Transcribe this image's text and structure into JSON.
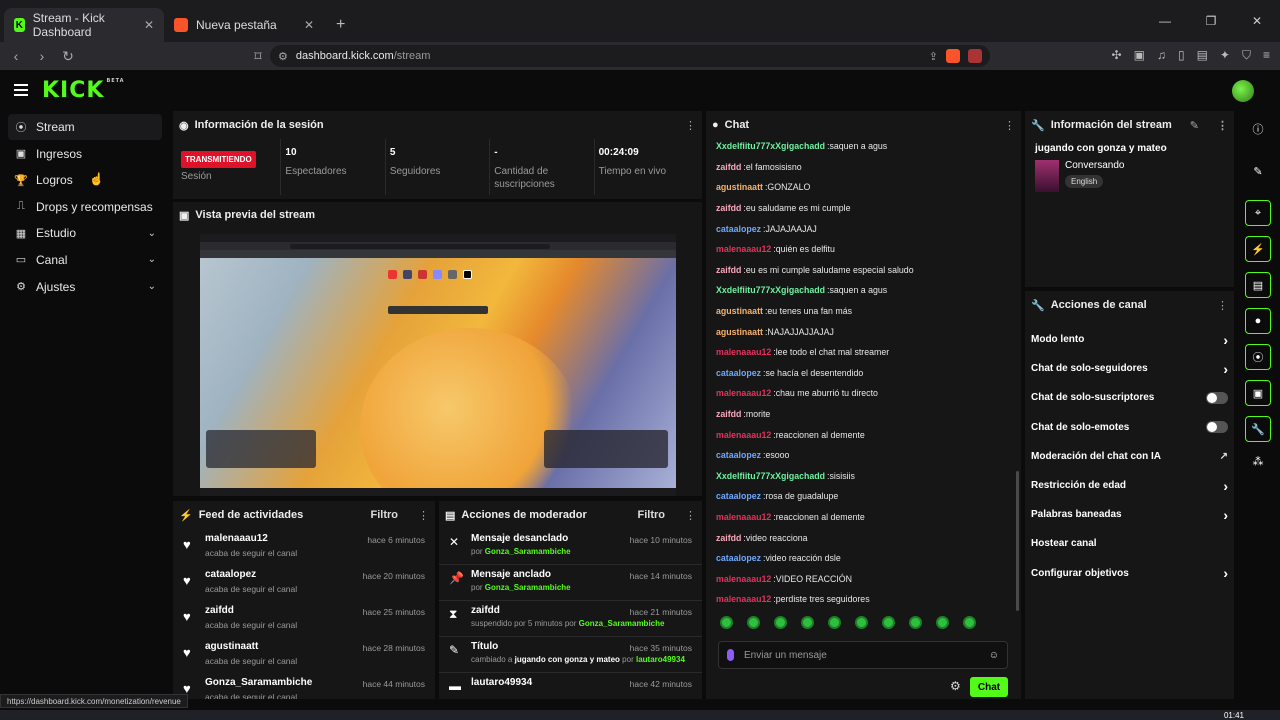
{
  "browser": {
    "tabs": [
      {
        "title": "Stream - Kick Dashboard",
        "active": true
      },
      {
        "title": "Nueva pestaña",
        "active": false
      }
    ],
    "url_host": "dashboard.kick.com",
    "url_path": "/stream",
    "status_url": "https://dashboard.kick.com/monetization/revenue",
    "clock": "01:41"
  },
  "brand": {
    "logo": "KICK",
    "beta": "BETA",
    "accent": "#53fc18"
  },
  "sidebar": {
    "items": [
      {
        "label": "Stream",
        "icon": "broadcast-icon",
        "chevron": false
      },
      {
        "label": "Ingresos",
        "icon": "revenue-icon",
        "chevron": false
      },
      {
        "label": "Logros",
        "icon": "trophy-icon",
        "chevron": false
      },
      {
        "label": "Drops y recompensas",
        "icon": "gift-icon",
        "chevron": false
      },
      {
        "label": "Estudio",
        "icon": "studio-icon",
        "chevron": true
      },
      {
        "label": "Canal",
        "icon": "channel-icon",
        "chevron": true
      },
      {
        "label": "Ajustes",
        "icon": "gear-icon",
        "chevron": true
      }
    ]
  },
  "session": {
    "title": "Información de la sesión",
    "live_badge": "TRANSMITIENDO",
    "stats": [
      {
        "value": "",
        "label": "Sesión"
      },
      {
        "value": "10",
        "label": "Espectadores"
      },
      {
        "value": "5",
        "label": "Seguidores"
      },
      {
        "value": "-",
        "label": "Cantidad de suscripciones"
      },
      {
        "value": "00:24:09",
        "label": "Tiempo en vivo"
      }
    ]
  },
  "preview": {
    "title": "Vista previa del stream"
  },
  "feed": {
    "title": "Feed de actividades",
    "filter": "Filtro",
    "items": [
      {
        "name": "malenaaau12",
        "desc": "acaba de seguir el canal",
        "time": "hace 6 minutos"
      },
      {
        "name": "cataalopez",
        "desc": "acaba de seguir el canal",
        "time": "hace 20 minutos"
      },
      {
        "name": "zaifdd",
        "desc": "acaba de seguir el canal",
        "time": "hace 25 minutos"
      },
      {
        "name": "agustinaatt",
        "desc": "acaba de seguir el canal",
        "time": "hace 28 minutos"
      },
      {
        "name": "Gonza_Saramambiche",
        "desc": "acaba de seguir el canal",
        "time": "hace 44 minutos"
      }
    ]
  },
  "mod": {
    "title": "Acciones de moderador",
    "filter": "Filtro",
    "items": [
      {
        "name": "Mensaje desanclado",
        "pre": "por",
        "user": "Gonza_Saramambiche",
        "time": "hace 10 minutos",
        "icon": "unpin-icon"
      },
      {
        "name": "Mensaje anclado",
        "pre": "por",
        "user": "Gonza_Saramambiche",
        "time": "hace 14 minutos",
        "icon": "pin-icon"
      },
      {
        "name": "zaifdd",
        "pre": "suspendido por 5 minutos por",
        "user": "Gonza_Saramambiche",
        "time": "hace 21 minutos",
        "icon": "hourglass-icon"
      },
      {
        "name": "Título",
        "pre": "cambiado a",
        "bold": "jugando con gonza y mateo",
        "post": "por",
        "user": "lautaro49934",
        "time": "hace 35 minutos",
        "icon": "title-edit-icon"
      },
      {
        "name": "lautaro49934",
        "pre": "",
        "user": "",
        "time": "hace 42 minutos",
        "icon": "mod-icon"
      }
    ]
  },
  "chat": {
    "title": "Chat",
    "placeholder": "Enviar un mensaje",
    "send": "Chat",
    "colors": {
      "green": "#6cf2a0",
      "orange": "#f6b26b",
      "pink": "#f7a8b8",
      "blue": "#6fa8ff",
      "red": "#e6305a"
    },
    "messages": [
      {
        "user": "Xxdelfiitu777xXgigachadd",
        "color": "green",
        "text": "saquen a agus"
      },
      {
        "user": "zaifdd",
        "color": "pink",
        "text": "el famosisisno"
      },
      {
        "user": "agustinaatt",
        "color": "orange",
        "text": "GONZALO"
      },
      {
        "user": "zaifdd",
        "color": "pink",
        "text": "eu saludame es mi cumple"
      },
      {
        "user": "cataalopez",
        "color": "blue",
        "text": "JAJAJAAJAJ"
      },
      {
        "user": "malenaaau12",
        "color": "red",
        "text": "quién es delfitu"
      },
      {
        "user": "zaifdd",
        "color": "pink",
        "text": "eu es mi cumple saludame especial saludo"
      },
      {
        "user": "Xxdelfiitu777xXgigachadd",
        "color": "green",
        "text": "saquen a agus"
      },
      {
        "user": "agustinaatt",
        "color": "orange",
        "text": "eu tenes una fan más"
      },
      {
        "user": "agustinaatt",
        "color": "orange",
        "text": "NAJAJJAJJAJAJ"
      },
      {
        "user": "malenaaau12",
        "color": "red",
        "text": "lee todo el chat mal streamer"
      },
      {
        "user": "cataalopez",
        "color": "blue",
        "text": "se hacía el desentendido"
      },
      {
        "user": "malenaaau12",
        "color": "red",
        "text": "chau me aburrió tu directo"
      },
      {
        "user": "zaifdd",
        "color": "pink",
        "text": "morite"
      },
      {
        "user": "malenaaau12",
        "color": "red",
        "text": "reaccionen al demente"
      },
      {
        "user": "cataalopez",
        "color": "blue",
        "text": "esooo"
      },
      {
        "user": "Xxdelfiitu777xXgigachadd",
        "color": "green",
        "text": "sisisiis"
      },
      {
        "user": "cataalopez",
        "color": "blue",
        "text": "rosa de guadalupe"
      },
      {
        "user": "malenaaau12",
        "color": "red",
        "text": "reaccionen al demente"
      },
      {
        "user": "zaifdd",
        "color": "pink",
        "text": "video reacciona"
      },
      {
        "user": "cataalopez",
        "color": "blue",
        "text": "video reacción dsle"
      },
      {
        "user": "malenaaau12",
        "color": "red",
        "text": "VIDEO REACCIÓN"
      },
      {
        "user": "malenaaau12",
        "color": "red",
        "text": "perdiste tres seguidores"
      }
    ]
  },
  "info": {
    "title": "Información del stream",
    "stream_title": "jugando con gonza y mateo",
    "category": "Conversando",
    "language": "English"
  },
  "actions": {
    "title": "Acciones de canal",
    "items": [
      {
        "label": "Modo lento",
        "kind": "chevron"
      },
      {
        "label": "Chat de solo-seguidores",
        "kind": "chevron"
      },
      {
        "label": "Chat de solo-suscriptores",
        "kind": "toggle"
      },
      {
        "label": "Chat de solo-emotes",
        "kind": "toggle"
      },
      {
        "label": "Moderación del chat con IA",
        "kind": "external"
      },
      {
        "label": "Restricción de edad",
        "kind": "chevron"
      },
      {
        "label": "Palabras baneadas",
        "kind": "chevron"
      },
      {
        "label": "Hostear canal",
        "kind": "none"
      },
      {
        "label": "Configurar objetivos",
        "kind": "chevron"
      }
    ]
  }
}
